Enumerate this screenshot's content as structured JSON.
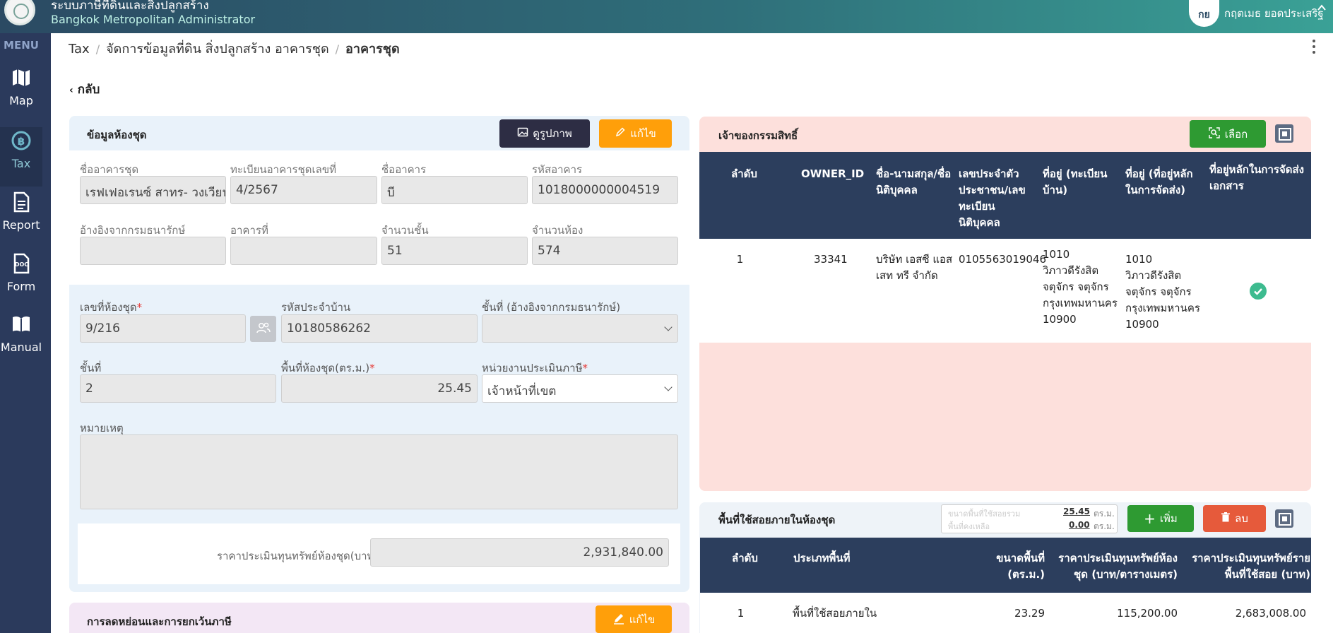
{
  "header": {
    "app_title": "ระบบภาษีที่ดินและสิ่งปลูกสร้าง",
    "app_subtitle": "Bangkok Metropolitan Administrator",
    "user_initials": "กย",
    "user_name": "กฤตเมธ ยอดประเสริฐ"
  },
  "sidebar": {
    "menu_label": "MENU",
    "items": [
      {
        "label": "Map",
        "icon": "map-icon"
      },
      {
        "label": "Tax",
        "icon": "baht-coin-icon"
      },
      {
        "label": "Report",
        "icon": "document-icon"
      },
      {
        "label": "Form",
        "icon": "doc-file-icon"
      },
      {
        "label": "Manual",
        "icon": "book-icon"
      }
    ]
  },
  "breadcrumb": {
    "items": [
      "Tax",
      "จัดการข้อมูลที่ดิน สิ่งปลูกสร้าง อาคารชุด",
      "อาคารชุด"
    ],
    "separator": "/"
  },
  "back_label": "กลับ",
  "room_info": {
    "title": "ข้อมูลห้องชุด",
    "view_image_label": "ดูรูปภาพ",
    "edit_label": "แก้ไข",
    "fields": {
      "building_name_label": "ชื่ออาคารชุด",
      "building_name_value": "เรฟเฟอเรนซ์ สาทร- วงเวียนใหญ่",
      "registration_label": "ทะเบียนอาคารชุดเลขที่",
      "registration_value": "4/2567",
      "building_label": "ชื่ออาคาร",
      "building_value": "บี",
      "building_code_label": "รหัสอาคาร",
      "building_code_value": "1018000000004519",
      "ref_label": "อ้างอิงจากกรมธนารักษ์",
      "ref_value": "",
      "building_no_label": "อาคารที่",
      "building_no_value": "",
      "floors_label": "จำนวนชั้น",
      "floors_value": "51",
      "rooms_label": "จำนวนห้อง",
      "rooms_value": "574"
    },
    "unit": {
      "room_no_label": "เลขที่ห้องชุด",
      "room_no_value": "9/216",
      "house_code_label": "รหัสประจำบ้าน",
      "house_code_value": "10180586262",
      "floor_ref_label": "ชั้นที่ (อ้างอิงจากกรมธนารักษ์)",
      "floor_ref_value": "",
      "floor_label": "ชั้นที่",
      "floor_value": "2",
      "area_label": "พื้นที่ห้องชุด(ตร.ม.)",
      "area_value": "25.45",
      "assessor_label": "หน่วยงานประเมินภาษี",
      "assessor_value": "เจ้าหน้าที่เขต",
      "note_label": "หมายเหตุ",
      "note_value": "",
      "appraisal_label": "ราคาประเมินทุนทรัพย์ห้องชุด(บาท)",
      "appraisal_value": "2,931,840.00"
    }
  },
  "exemption": {
    "title": "การลดหย่อนและการยกเว้นภาษี",
    "edit_label": "แก้ไข"
  },
  "owners": {
    "title": "เจ้าของกรรมสิทธิ์",
    "select_label": "เลือก",
    "headers": [
      "ลำดับ",
      "OWNER_ID",
      "ชื่อ-นามสกุล/ชื่อนิติบุคคล",
      "เลขประจำตัวประชาชน/เลขทะเบียนนิติบุคคล",
      "ที่อยู่ (ทะเบียนบ้าน)",
      "ที่อยู่ (ที่อยู่หลักในการจัดส่ง)",
      "ที่อยู่หลักในการจัดส่งเอกสาร"
    ],
    "rows": [
      {
        "no": "1",
        "owner_id": "33341",
        "name": "บริษัท เอสซี แอสเสท ทรี จำกัด",
        "tax_id": "0105563019046",
        "address": "1010 วิภาวดีรังสิต จตุจักร จตุจักร กรุงเทพมหานคร 10900",
        "mail_address": "1010 วิภาวดีรังสิต จตุจักร จตุจักร กรุงเทพมหานคร 10900",
        "primary": true
      }
    ]
  },
  "usage": {
    "title": "พื้นที่ใช้สอยภายในห้องชุด",
    "summary_total_label": "ขนาดพื้นที่ใช้สอยรวม",
    "summary_total_value": "25.45",
    "summary_remaining_label": "พื้นที่คงเหลือ",
    "summary_remaining_value": "0.00",
    "unit": "ตร.ม.",
    "add_label": "เพิ่ม",
    "delete_label": "ลบ",
    "headers": [
      "ลำดับ",
      "ประเภทพื้นที่",
      "ขนาดพื้นที่ (ตร.ม.)",
      "ราคาประเมินทุนทรัพย์ห้องชุด (บาท/ตารางเมตร)",
      "ราคาประเมินทุนทรัพย์รายพื้นที่ใช้สอย (บาท)"
    ],
    "rows": [
      {
        "no": "1",
        "type": "พื้นที่ใช้สอยภายใน",
        "area": "23.29",
        "price_per_sqm": "115,200.00",
        "appraisal": "2,683,008.00"
      }
    ]
  },
  "colors": {
    "sidebar": "#2b3a5c",
    "table_header": "#2c3e5d",
    "owner_panel": "#fde0dc",
    "info_panel": "#e9f2fa",
    "exemption_panel": "#f3e7f5",
    "accent_orange": "#ff9f0a",
    "accent_green": "#2e9a32",
    "accent_red": "#e65a3b",
    "check_green": "#3dbb8f"
  }
}
